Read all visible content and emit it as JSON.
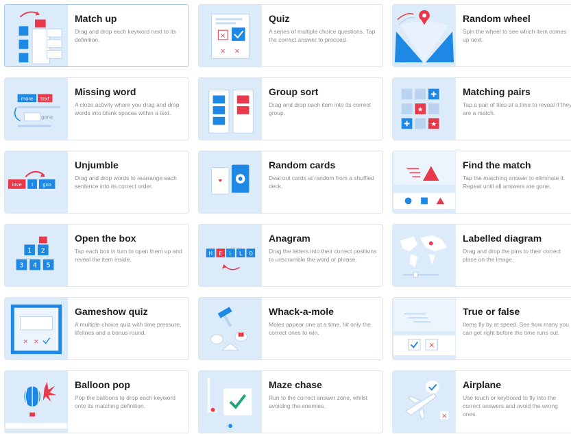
{
  "templates": [
    {
      "id": "match-up",
      "title": "Match up",
      "desc": "Drag and drop each keyword next to its definition."
    },
    {
      "id": "quiz",
      "title": "Quiz",
      "desc": "A series of multiple choice questions. Tap the correct answer to proceed."
    },
    {
      "id": "random-wheel",
      "title": "Random wheel",
      "desc": "Spin the wheel to see which item comes up next."
    },
    {
      "id": "missing-word",
      "title": "Missing word",
      "desc": "A cloze activity where you drag and drop words into blank spaces within a text.",
      "thumb_words": [
        "more",
        "text",
        "gone"
      ]
    },
    {
      "id": "group-sort",
      "title": "Group sort",
      "desc": "Drag and drop each item into its correct group."
    },
    {
      "id": "matching-pairs",
      "title": "Matching pairs",
      "desc": "Tap a pair of tiles at a time to reveal if they are a match."
    },
    {
      "id": "unjumble",
      "title": "Unjumble",
      "desc": "Drag and drop words to rearrange each sentence into its correct order.",
      "thumb_words": [
        "love",
        "I",
        "goo"
      ]
    },
    {
      "id": "random-cards",
      "title": "Random cards",
      "desc": "Deal out cards at random from a shuffled deck."
    },
    {
      "id": "find-the-match",
      "title": "Find the match",
      "desc": "Tap the matching answer to eliminate it. Repeat until all answers are gone."
    },
    {
      "id": "open-the-box",
      "title": "Open the box",
      "desc": "Tap each box in turn to open them up and reveal the item inside.",
      "thumb_numbers": [
        "1",
        "2",
        "3",
        "4",
        "5"
      ]
    },
    {
      "id": "anagram",
      "title": "Anagram",
      "desc": "Drag the letters into their correct positions to unscramble the word or phrase.",
      "thumb_letters": [
        "H",
        "E",
        "L",
        "L",
        "O"
      ]
    },
    {
      "id": "labelled-diagram",
      "title": "Labelled diagram",
      "desc": "Drag and drop the pins to their correct place on the image."
    },
    {
      "id": "gameshow-quiz",
      "title": "Gameshow quiz",
      "desc": "A multiple choice quiz with time pressure, lifelines and a bonus round."
    },
    {
      "id": "whack-a-mole",
      "title": "Whack-a-mole",
      "desc": "Moles appear one at a time, hit only the correct ones to win."
    },
    {
      "id": "true-or-false",
      "title": "True or false",
      "desc": "Items fly by at speed. See how many you can get right before the time runs out."
    },
    {
      "id": "balloon-pop",
      "title": "Balloon pop",
      "desc": "Pop the balloons to drop each keyword onto its matching definition."
    },
    {
      "id": "maze-chase",
      "title": "Maze chase",
      "desc": "Run to the correct answer zone, whilst avoiding the enemies."
    },
    {
      "id": "airplane",
      "title": "Airplane",
      "desc": "Use touch or keyboard to fly into the correct answers and avoid the wrong ones."
    }
  ],
  "colors": {
    "accent": "#1e88e5",
    "red": "#e8394a",
    "thumb_bg": "#dcebfa",
    "border": "#dfe3ea"
  }
}
